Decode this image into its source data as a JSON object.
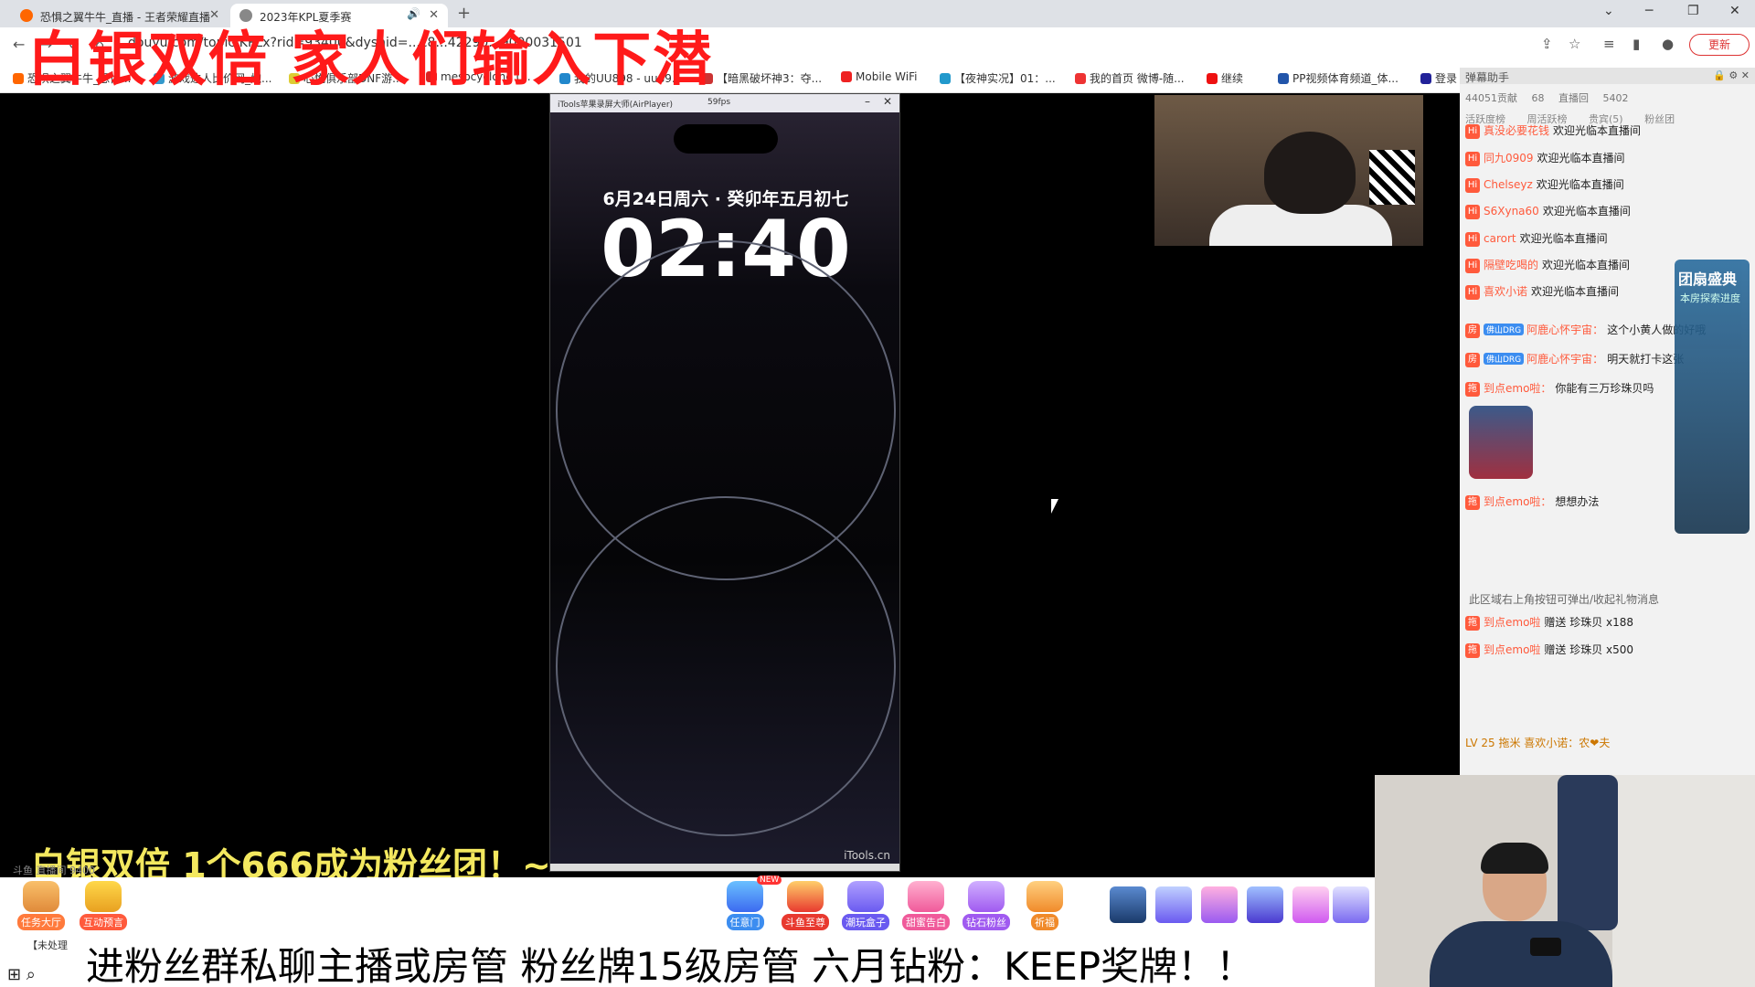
{
  "browser": {
    "tabs": [
      {
        "label": "恐惧之翼牛牛_直播 - 王者荣耀直播"
      },
      {
        "label": "2023年KPL夏季赛"
      }
    ],
    "new_tab": "+",
    "url": "douyu.com/topic/KPLx?rid=93400&dyshid=...c8...42290...9000031501",
    "update_label": "更新",
    "bookmarks": [
      "恐惧之翼牛牛_恐惧...",
      "游戏达人比价网_炮...",
      "心悦俱乐部DNF游...",
      "mesocyclone (...",
      "我的UU898 - uu89...",
      "【暗黑破坏神3：夺...",
      "Mobile WiFi",
      "【夜神实况】01：...",
      "我的首页 微博-随...",
      "继续",
      "PP视频体育频道_体...",
      "登录"
    ]
  },
  "overlay": {
    "title": "白银双倍 家人们输入下潜",
    "subtitle": "白银双倍 1个666成为粉丝团！~",
    "bottom_text": "进粉丝群私聊主播或房管 粉丝牌15级房管 六月钻粉：KEEP奖牌！！",
    "watermark": "斗鱼 直播间 9400"
  },
  "phone": {
    "window_title": "iTools苹果录屏大师(AirPlayer)",
    "fps": "59fps",
    "date": "6月24日周六 · 癸卯年五月初七",
    "time": "02:40",
    "brand": "iTools.cn"
  },
  "chat": {
    "header": "弹幕助手",
    "stats": [
      "44051贡献",
      "68",
      "直播回",
      "5402"
    ],
    "tabs": [
      "活跃度榜",
      "周活跃榜",
      "贵宾(5)",
      "粉丝团"
    ],
    "messages": [
      {
        "badge": "Hi",
        "user": "真没必要花钱",
        "text": "欢迎光临本直播间"
      },
      {
        "badge": "Hi",
        "user": "同九0909",
        "text": "欢迎光临本直播间"
      },
      {
        "badge": "Hi",
        "user": "Chelseyz",
        "text": "欢迎光临本直播间"
      },
      {
        "badge": "Hi",
        "user": "S6Xyna60",
        "text": "欢迎光临本直播间"
      },
      {
        "badge": "Hi",
        "user": "carort",
        "text": "欢迎光临本直播间"
      },
      {
        "badge": "Hi",
        "user": "隔壁吃喝的",
        "text": "欢迎光临本直播间"
      },
      {
        "badge": "Hi",
        "user": "喜欢小诺",
        "text": "欢迎光临本直播间"
      },
      {
        "badge": "房",
        "user": "阿鹿心怀宇宙：",
        "text": "这个小黄人做的好哦"
      },
      {
        "badge": "房",
        "user": "阿鹿心怀宇宙：",
        "text": "明天就打卡这张"
      },
      {
        "badge": "拖",
        "user": "到点emo啦：",
        "text": "你能有三万珍珠贝吗"
      },
      {
        "badge": "拖",
        "user": "到点emo啦：",
        "text": "想想办法"
      },
      {
        "badge": "拖",
        "user": "到点emo啦",
        "text": "赠送 珍珠贝 x188"
      },
      {
        "badge": "拖",
        "user": "到点emo啦",
        "text": "赠送 珍珠贝 x500"
      }
    ],
    "hint": "此区域右上角按钮可弹出/收起礼物消息",
    "side_title": "团扇盛典",
    "side_sub": "本房探索进度",
    "level_line": "LV 25  拖米  喜欢小诺：农❤夫"
  },
  "toolbar": {
    "left_items": [
      {
        "label": "任务大厅",
        "color": "#ff7a3c"
      },
      {
        "label": "互动预言",
        "color": "#ff5a3c"
      }
    ],
    "right_items": [
      {
        "label": "任意门",
        "color": "#3c8df0"
      },
      {
        "label": "斗鱼至尊",
        "color": "#e8392f"
      },
      {
        "label": "潮玩盒子",
        "color": "#6a5af0"
      },
      {
        "label": "甜蜜告白",
        "color": "#f05a9a"
      },
      {
        "label": "钻石粉丝",
        "color": "#a05af0"
      },
      {
        "label": "祈福",
        "color": "#f08a2a"
      }
    ],
    "new_badge": "NEW",
    "notice": "【未处理"
  }
}
